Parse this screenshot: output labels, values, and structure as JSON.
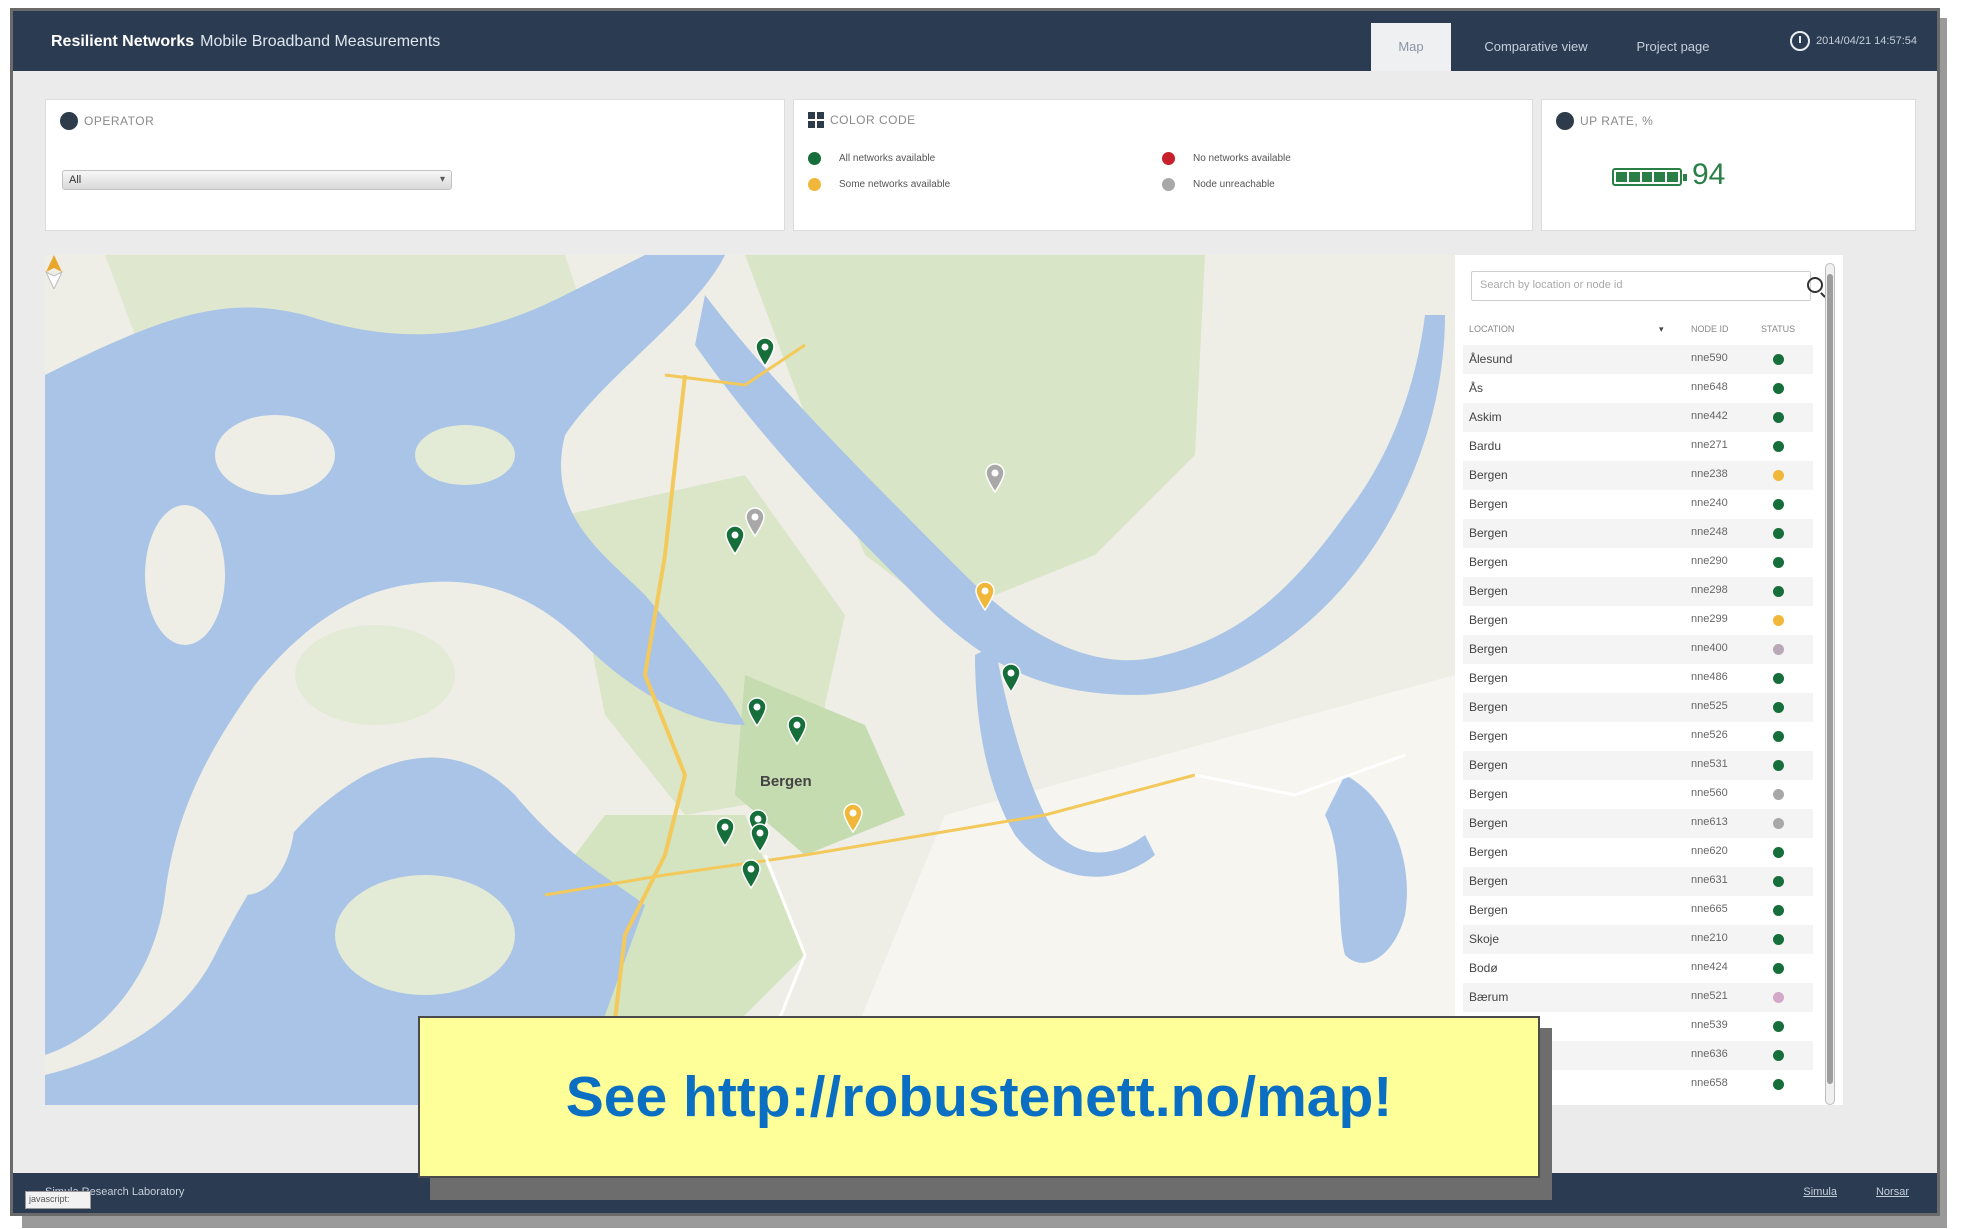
{
  "header": {
    "brand_bold": "Resilient Networks",
    "brand_rest": "Mobile Broadband Measurements",
    "tabs": [
      "Map",
      "Comparative view",
      "Project page"
    ],
    "timestamp": "2014/04/21 14:57:54"
  },
  "operator_panel": {
    "title": "OPERATOR",
    "selected": "All"
  },
  "color_code_panel": {
    "title": "COLOR CODE",
    "items": [
      {
        "label": "All networks available",
        "color": "#166e3a"
      },
      {
        "label": "No networks available",
        "color": "#c8202a"
      },
      {
        "label": "Some networks available",
        "color": "#f0b73a"
      },
      {
        "label": "Node unreachable",
        "color": "#a8a8a8"
      }
    ]
  },
  "uprate_panel": {
    "title": "UP RATE, %",
    "value": "94",
    "level": 0.94
  },
  "map": {
    "city_label": "Bergen"
  },
  "search": {
    "placeholder": "Search by location or node id"
  },
  "table": {
    "headers": {
      "location": "LOCATION",
      "node_id": "NODE ID",
      "status": "STATUS"
    },
    "rows": [
      {
        "location": "Ålesund",
        "node_id": "nne590",
        "status": "#166e3a"
      },
      {
        "location": "Ås",
        "node_id": "nne648",
        "status": "#166e3a"
      },
      {
        "location": "Askim",
        "node_id": "nne442",
        "status": "#166e3a"
      },
      {
        "location": "Bardu",
        "node_id": "nne271",
        "status": "#166e3a"
      },
      {
        "location": "Bergen",
        "node_id": "nne238",
        "status": "#f0b73a"
      },
      {
        "location": "Bergen",
        "node_id": "nne240",
        "status": "#166e3a"
      },
      {
        "location": "Bergen",
        "node_id": "nne248",
        "status": "#166e3a"
      },
      {
        "location": "Bergen",
        "node_id": "nne290",
        "status": "#166e3a"
      },
      {
        "location": "Bergen",
        "node_id": "nne298",
        "status": "#166e3a"
      },
      {
        "location": "Bergen",
        "node_id": "nne299",
        "status": "#f0b73a"
      },
      {
        "location": "Bergen",
        "node_id": "nne400",
        "status": "#b9a8b8"
      },
      {
        "location": "Bergen",
        "node_id": "nne486",
        "status": "#166e3a"
      },
      {
        "location": "Bergen",
        "node_id": "nne525",
        "status": "#166e3a"
      },
      {
        "location": "Bergen",
        "node_id": "nne526",
        "status": "#166e3a"
      },
      {
        "location": "Bergen",
        "node_id": "nne531",
        "status": "#166e3a"
      },
      {
        "location": "Bergen",
        "node_id": "nne560",
        "status": "#a8a8a8"
      },
      {
        "location": "Bergen",
        "node_id": "nne613",
        "status": "#a8a8a8"
      },
      {
        "location": "Bergen",
        "node_id": "nne620",
        "status": "#166e3a"
      },
      {
        "location": "Bergen",
        "node_id": "nne631",
        "status": "#166e3a"
      },
      {
        "location": "Bergen",
        "node_id": "nne665",
        "status": "#166e3a"
      },
      {
        "location": "Skoje",
        "node_id": "nne210",
        "status": "#166e3a"
      },
      {
        "location": "Bodø",
        "node_id": "nne424",
        "status": "#166e3a"
      },
      {
        "location": "Bærum",
        "node_id": "nne521",
        "status": "#d4a8c8"
      },
      {
        "location": "",
        "node_id": "nne539",
        "status": "#166e3a"
      },
      {
        "location": "",
        "node_id": "nne636",
        "status": "#166e3a"
      },
      {
        "location": "",
        "node_id": "nne658",
        "status": "#166e3a"
      }
    ]
  },
  "footer": {
    "text": "Simula Research Laboratory",
    "links": [
      "Simula",
      "Norsar"
    ],
    "corner_tag": "javascript:"
  },
  "callout": {
    "text": "See http://robustenett.no/map!"
  }
}
